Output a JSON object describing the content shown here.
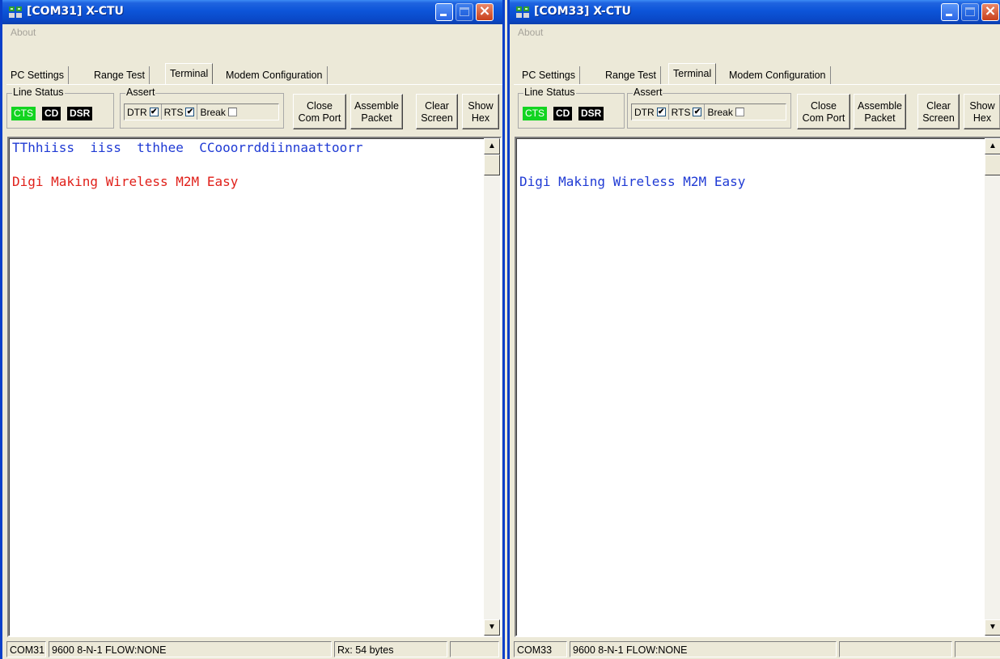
{
  "colors": {
    "title_bar": "#0a49c8",
    "led_on": "#12d420",
    "led_off": "#000000",
    "text_sent": "#1f3ad4",
    "text_received": "#e0201a"
  },
  "windows": [
    {
      "title": "[COM31] X-CTU",
      "menu_about": "About",
      "tabs": [
        "PC Settings",
        "Range Test",
        "Terminal",
        "Modem Configuration"
      ],
      "active_tab": "Terminal",
      "line_status": {
        "label": "Line Status",
        "cts": "CTS",
        "cd": "CD",
        "dsr": "DSR"
      },
      "assert": {
        "label": "Assert",
        "dtr": "DTR",
        "dtr_checked": "✔",
        "rts": "RTS",
        "rts_checked": "✔",
        "break": "Break"
      },
      "buttons": {
        "close_port": [
          "Close",
          "Com Port"
        ],
        "assemble_packet": [
          "Assemble",
          "Packet"
        ],
        "clear_screen": [
          "Clear",
          "Screen"
        ],
        "show_hex": [
          "Show",
          "Hex"
        ]
      },
      "terminal": {
        "line1": "TThhiiss  iiss  tthhee  CCooorrddiinnaattoorr",
        "line2": "Digi Making Wireless M2M Easy"
      },
      "status": {
        "port": "COM31",
        "settings": "9600 8-N-1  FLOW:NONE",
        "rx": "Rx: 54 bytes"
      }
    },
    {
      "title": "[COM33] X-CTU",
      "menu_about": "About",
      "tabs": [
        "PC Settings",
        "Range Test",
        "Terminal",
        "Modem Configuration"
      ],
      "active_tab": "Terminal",
      "line_status": {
        "label": "Line Status",
        "cts": "CTS",
        "cd": "CD",
        "dsr": "DSR"
      },
      "assert": {
        "label": "Assert",
        "dtr": "DTR",
        "dtr_checked": "✔",
        "rts": "RTS",
        "rts_checked": "✔",
        "break": "Break"
      },
      "buttons": {
        "close_port": [
          "Close",
          "Com Port"
        ],
        "assemble_packet": [
          "Assemble",
          "Packet"
        ],
        "clear_screen": [
          "Clear",
          "Screen"
        ],
        "show_hex": [
          "Show",
          "Hex"
        ]
      },
      "terminal": {
        "line1": "Digi Making Wireless M2M Easy"
      },
      "status": {
        "port": "COM33",
        "settings": "9600 8-N-1  FLOW:NONE",
        "rx": ""
      }
    }
  ]
}
